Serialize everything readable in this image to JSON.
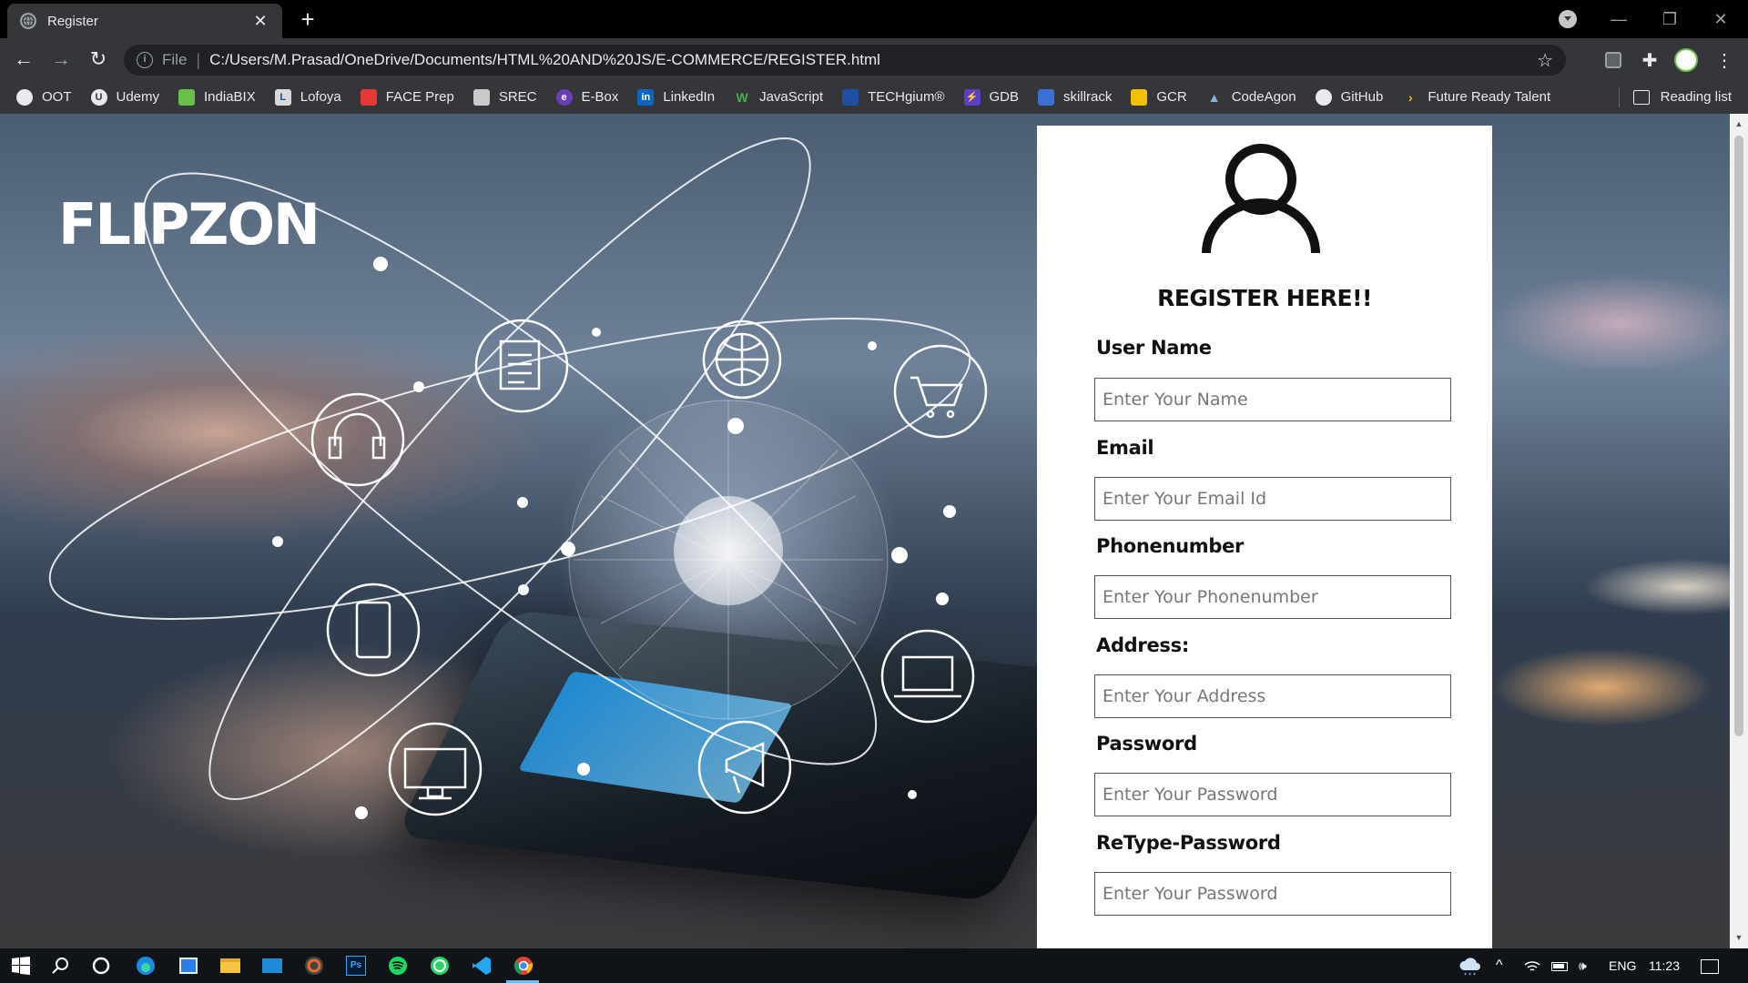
{
  "browser": {
    "tab_title": "Register",
    "address_scheme": "File",
    "address_url": "C:/Users/M.Prasad/OneDrive/Documents/HTML%20AND%20JS/E-COMMERCE/REGISTER.html",
    "reading_list": "Reading list"
  },
  "bookmarks": [
    {
      "label": "OOT",
      "icon": "globe-icon",
      "color": "#e8eaed"
    },
    {
      "label": "Udemy",
      "icon": "udemy-icon",
      "color": "#e8eaed"
    },
    {
      "label": "IndiaBIX",
      "icon": "indiabix-icon",
      "color": "#6abf4b"
    },
    {
      "label": "Lofoya",
      "icon": "lofoya-icon",
      "color": "#d9d9d9"
    },
    {
      "label": "FACE Prep",
      "icon": "faceprep-icon",
      "color": "#e53935"
    },
    {
      "label": "SREC",
      "icon": "srec-icon",
      "color": "#c9c9c9"
    },
    {
      "label": "E-Box",
      "icon": "ebox-icon",
      "color": "#6a3fb5"
    },
    {
      "label": "LinkedIn",
      "icon": "linkedin-icon",
      "color": "#0a66c2"
    },
    {
      "label": "JavaScript",
      "icon": "javascript-icon",
      "color": "#2e7d32"
    },
    {
      "label": "TECHgium®",
      "icon": "techgium-icon",
      "color": "#1e4fa3"
    },
    {
      "label": "GDB",
      "icon": "gdb-icon",
      "color": "#5c3fc4"
    },
    {
      "label": "skillrack",
      "icon": "skillrack-icon",
      "color": "#3b6fd1"
    },
    {
      "label": "GCR",
      "icon": "gcr-icon",
      "color": "#f2c200"
    },
    {
      "label": "CodeAgon",
      "icon": "codeagon-icon",
      "color": "#8fb3d9"
    },
    {
      "label": "GitHub",
      "icon": "github-icon",
      "color": "#e8eaed"
    },
    {
      "label": "Future Ready Talent",
      "icon": "future-ready-icon",
      "color": "#f2c200"
    }
  ],
  "page": {
    "brand": "FLIPZON",
    "form_title": "REGISTER HERE!!",
    "fields": [
      {
        "label": "User Name",
        "placeholder": "Enter Your Name"
      },
      {
        "label": "Email",
        "placeholder": "Enter Your Email Id"
      },
      {
        "label": "Phonenumber",
        "placeholder": "Enter Your Phonenumber"
      },
      {
        "label": "Address:",
        "placeholder": "Enter Your Address"
      },
      {
        "label": "Password",
        "placeholder": "Enter Your Password"
      },
      {
        "label": "ReType-Password",
        "placeholder": "Enter Your Password"
      }
    ]
  },
  "taskbar": {
    "language": "ENG",
    "time": "11:23"
  },
  "colors": {
    "chrome_dark": "#35363a",
    "card_bg": "#ffffff",
    "taskbar": "#101418"
  }
}
